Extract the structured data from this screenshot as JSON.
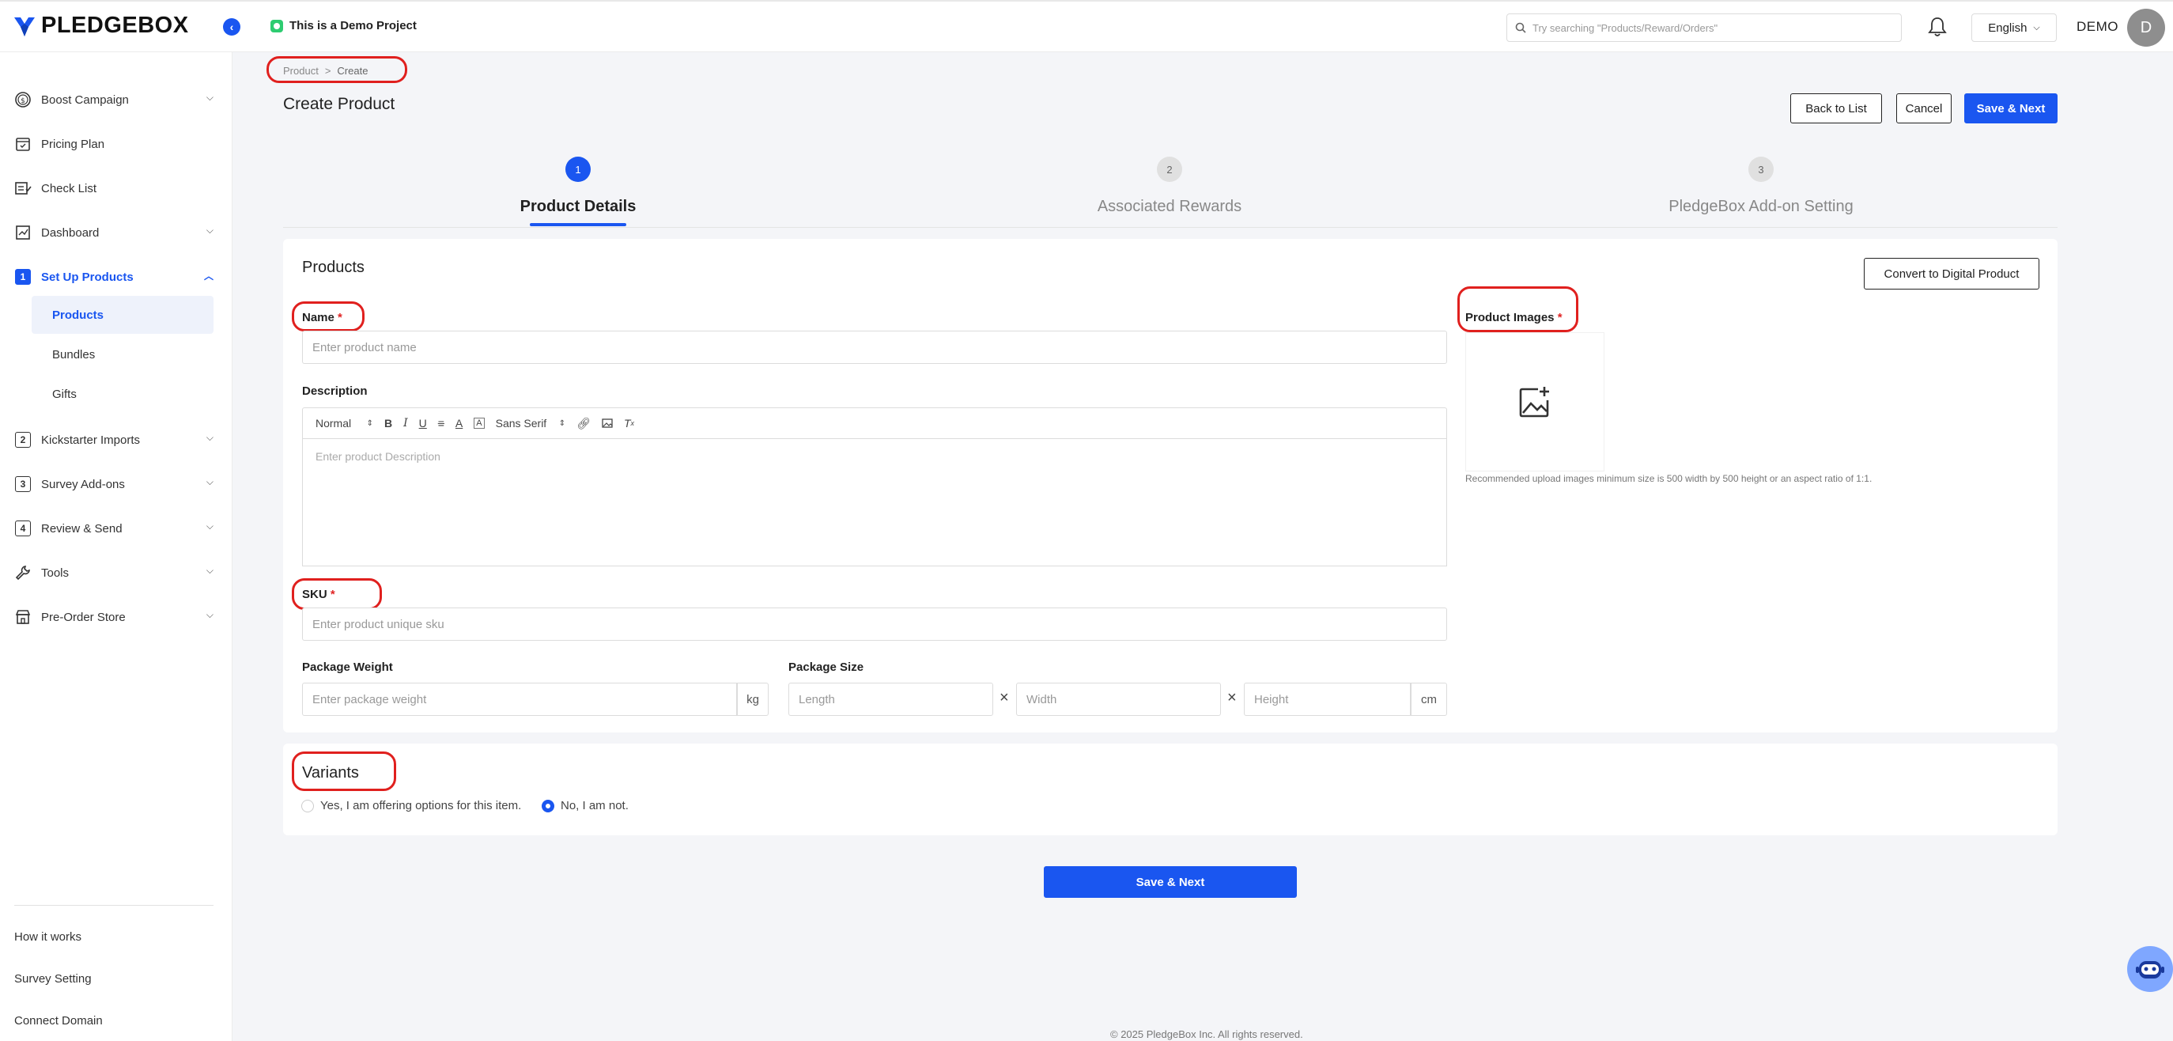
{
  "app": {
    "brand": "PLEDGEBOX",
    "project_label": "This is a Demo Project",
    "search_placeholder": "Try searching \"Products/Reward/Orders\"",
    "language": "English",
    "user_name": "DEMO",
    "avatar_initial": "D",
    "accent_color": "#1a56f0"
  },
  "sidebar": {
    "items": [
      {
        "label": "Boost Campaign",
        "icon": "dollar-circle-icon"
      },
      {
        "label": "Pricing Plan",
        "icon": "calendar-icon"
      },
      {
        "label": "Check List",
        "icon": "checklist-icon"
      },
      {
        "label": "Dashboard",
        "icon": "chart-icon"
      },
      {
        "label": "Set Up Products",
        "number": "1"
      },
      {
        "label": "Kickstarter Imports",
        "number": "2"
      },
      {
        "label": "Survey Add-ons",
        "number": "3"
      },
      {
        "label": "Review & Send",
        "number": "4"
      },
      {
        "label": "Tools",
        "icon": "wrench-icon"
      },
      {
        "label": "Pre-Order Store",
        "icon": "store-icon"
      }
    ],
    "sub_items": [
      "Products",
      "Bundles",
      "Gifts"
    ],
    "bottom_links": [
      "How it works",
      "Survey Setting",
      "Connect Domain"
    ]
  },
  "breadcrumb": {
    "root": "Product",
    "separator": ">",
    "current": "Create"
  },
  "page": {
    "title": "Create Product",
    "back_label": "Back to List",
    "cancel_label": "Cancel",
    "save_next_label": "Save & Next"
  },
  "steps": [
    {
      "number": "1",
      "label": "Product Details"
    },
    {
      "number": "2",
      "label": "Associated Rewards"
    },
    {
      "number": "3",
      "label": "PledgeBox Add-on Setting"
    }
  ],
  "products_card": {
    "title": "Products",
    "convert_label": "Convert to Digital Product",
    "name_label": "Name",
    "required_mark": "*",
    "name_placeholder": "Enter product name",
    "description_label": "Description",
    "editor_format": "Normal",
    "editor_font": "Sans Serif",
    "description_placeholder": "Enter product Description",
    "sku_label": "SKU",
    "sku_placeholder": "Enter product unique sku",
    "weight_label": "Package Weight",
    "weight_placeholder": "Enter package weight",
    "weight_unit": "kg",
    "size_label": "Package Size",
    "length_placeholder": "Length",
    "width_placeholder": "Width",
    "height_placeholder": "Height",
    "size_unit": "cm",
    "times": "×",
    "images_label": "Product Images",
    "images_hint": "Recommended upload images minimum size is 500 width by 500 height or an aspect ratio of 1:1."
  },
  "variants_card": {
    "title": "Variants",
    "option_yes": "Yes, I am offering options for this item.",
    "option_no": "No, I am not.",
    "selected": "no"
  },
  "bottom_save_label": "Save & Next",
  "footer": "© 2025 PledgeBox Inc. All rights reserved."
}
